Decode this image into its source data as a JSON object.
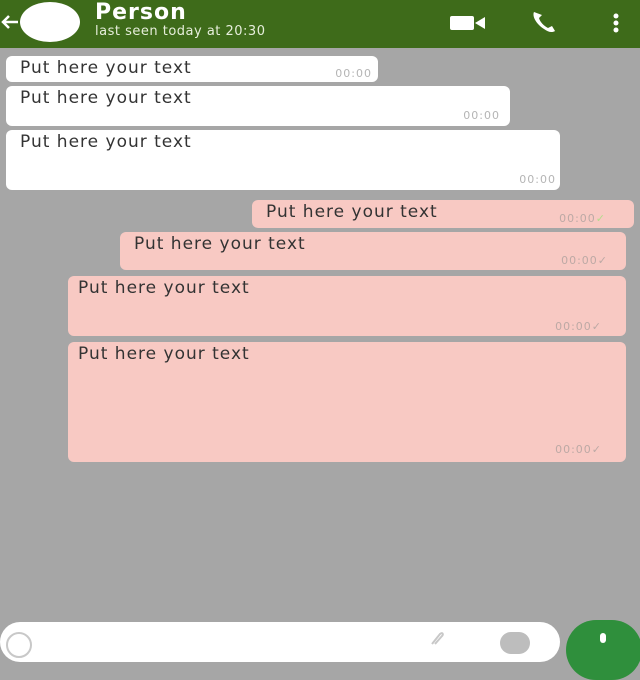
{
  "header": {
    "title": "Person",
    "subtitle": "last seen today at 20:30",
    "icons": [
      "back-arrow-icon",
      "avatar",
      "video-camera-icon",
      "phone-icon",
      "more-vert-icon"
    ],
    "color": "#3e6b1a"
  },
  "messages": [
    {
      "direction": "incoming",
      "text": "Put here your text",
      "time": "00:00"
    },
    {
      "direction": "incoming",
      "text": "Put here your text",
      "time": "00:00"
    },
    {
      "direction": "incoming",
      "text": "Put here your text",
      "time": "00:00"
    },
    {
      "direction": "outgoing",
      "text": "Put here your text",
      "time": "00:00",
      "status": "read"
    },
    {
      "direction": "outgoing",
      "text": "Put here your text",
      "time": "00:00",
      "status": "sent"
    },
    {
      "direction": "outgoing",
      "text": "Put here your text",
      "time": "00:00",
      "status": "sent"
    },
    {
      "direction": "outgoing",
      "text": "Put here your text",
      "time": "00:00",
      "status": "sent"
    }
  ],
  "colors": {
    "background": "#a6a6a6",
    "incoming_bubble": "#ffffff",
    "outgoing_bubble": "#f8c9c3",
    "read_check": "#b4dc8c",
    "mic_button": "#2f8f3c"
  },
  "composer": {
    "icons": [
      "emoji-icon",
      "attach-icon",
      "camera-icon",
      "mic-icon"
    ]
  }
}
